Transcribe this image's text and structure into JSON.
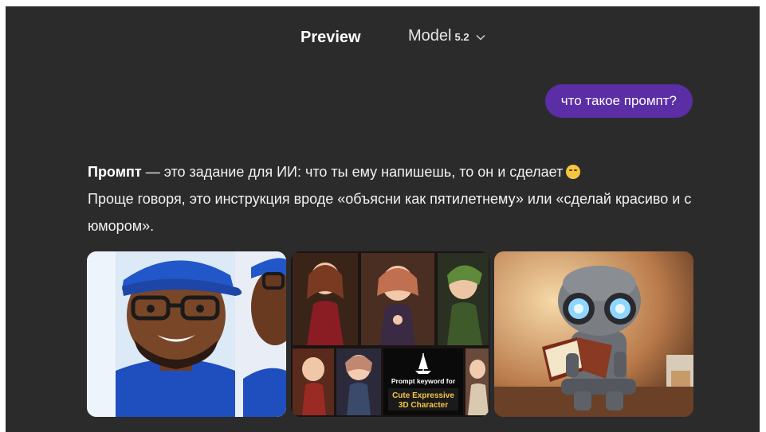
{
  "header": {
    "preview_tab": "Preview",
    "model_label": "Model",
    "model_version": "5.2"
  },
  "conversation": {
    "user_message": "что такое промпт?",
    "answer_term": "Промпт",
    "answer_line1": " — это задание для ИИ: что ты ему напишешь, то он и сделает",
    "answer_line2": "Проще говоря, это инструкция вроде «объясни как пятилетнему» или «сделай красиво и с юмором»."
  },
  "images": {
    "middle_card_line1": "Prompt keyword for",
    "middle_card_line2": "Cute Expressive",
    "middle_card_line3": "3D Character",
    "accent_yellow": "#f5c542",
    "bubble_color": "#5b2ea6"
  }
}
